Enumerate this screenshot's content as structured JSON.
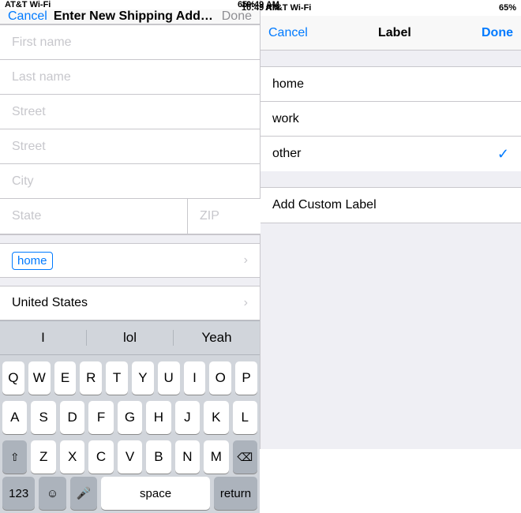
{
  "left": {
    "status": {
      "carrier": "AT&T Wi-Fi",
      "time": "10:49 AM",
      "battery": "65%"
    },
    "nav": {
      "cancel": "Cancel",
      "title": "Enter New Shipping Addres...",
      "done": "Done"
    },
    "form": {
      "first_name_placeholder": "First name",
      "last_name_placeholder": "Last name",
      "street1_placeholder": "Street",
      "street2_placeholder": "Street",
      "city_placeholder": "City",
      "state_placeholder": "State",
      "zip_placeholder": "ZIP",
      "country": "United States",
      "label_value": "home"
    },
    "suggestions": [
      "I",
      "lol",
      "Yeah"
    ],
    "keyboard": {
      "row1": [
        "Q",
        "W",
        "E",
        "R",
        "T",
        "Y",
        "U",
        "I",
        "O",
        "P"
      ],
      "row2": [
        "A",
        "S",
        "D",
        "F",
        "G",
        "H",
        "J",
        "K",
        "L"
      ],
      "row3": [
        "Z",
        "X",
        "C",
        "V",
        "B",
        "N",
        "M"
      ],
      "bottom": {
        "num": "123",
        "emoji": "☺",
        "mic": "🎤",
        "space": "space",
        "return": "return"
      }
    }
  },
  "right": {
    "status": {
      "carrier": "AT&T Wi-Fi",
      "time": "10:49 AM",
      "battery": "65%"
    },
    "nav": {
      "cancel": "Cancel",
      "title": "Label",
      "done": "Done"
    },
    "options": [
      {
        "id": "home",
        "label": "home",
        "selected": false
      },
      {
        "id": "work",
        "label": "work",
        "selected": false
      },
      {
        "id": "other",
        "label": "other",
        "selected": true
      }
    ],
    "custom_label": "Add Custom Label"
  }
}
